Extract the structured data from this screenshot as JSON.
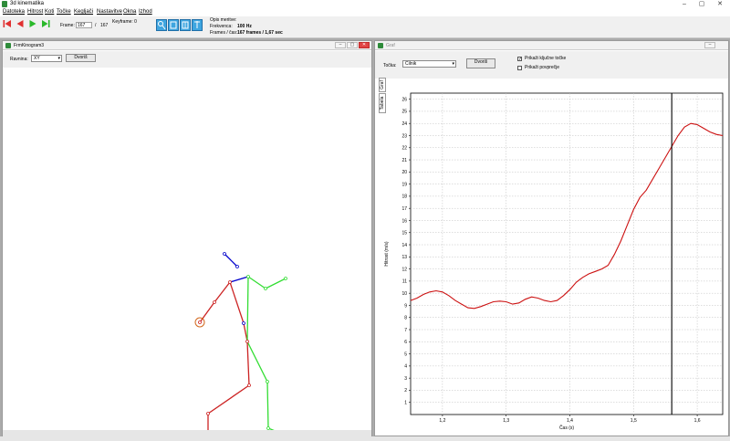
{
  "app": {
    "title": "3d kinematika"
  },
  "window_buttons": {
    "minimize": "–",
    "maximize": "▢",
    "close": "✕"
  },
  "menu": [
    "Datoteka",
    "Hitrost",
    "Koti",
    "Točke",
    "Kegljači",
    "Nastavitve",
    "Okna",
    "Izhod"
  ],
  "toolbar": {
    "frame_label": "Frame:",
    "frame_value": "167",
    "frame_separator": "/",
    "frame_total": "167",
    "keyframe_label": "Keyframe: 0",
    "info": {
      "desc_label": "Opis meritve:",
      "freq_label": "Frekvenca:",
      "freq_value": "100 Hz",
      "frames_label": "Frames / čas:",
      "frames_value": "167 frames / 1,67 sec"
    }
  },
  "left_window": {
    "title": "FrmKinogram3",
    "ravnina_label": "Ravnina:",
    "ravnina_value": "XY",
    "button_label": "Dvoriš"
  },
  "right_window": {
    "title": "Graf",
    "tocka_label": "Točka:",
    "tocka_value": "Cilnik",
    "button_label": "Dvoriš",
    "cb_kljucne": "Prikaži ključne točke",
    "cb_kljucne_checked": true,
    "cb_povprecje": "Prikaži povprečje",
    "cb_povprecje_checked": false,
    "vtab_1": "Graf",
    "vtab_2": "Tabela"
  },
  "colors": {
    "line": "#cc1111",
    "skeleton_left": "#cc2222",
    "skeleton_right": "#33dd33",
    "head": "#0000cc",
    "accent": "#3fa6e0"
  },
  "chart_data": {
    "type": "line",
    "xlabel": "Čas (s)",
    "ylabel": "Hitrost (m/s)",
    "xlim": [
      1.15,
      1.64
    ],
    "ylim": [
      0,
      26.5
    ],
    "xticks": [
      1.2,
      1.3,
      1.4,
      1.5,
      1.6
    ],
    "xtick_labels": [
      "1,2",
      "1,3",
      "1,4",
      "1,5",
      "1,6"
    ],
    "yticks": [
      1,
      2,
      3,
      4,
      5,
      6,
      7,
      8,
      9,
      10,
      11,
      12,
      13,
      14,
      15,
      16,
      17,
      18,
      19,
      20,
      21,
      22,
      23,
      24,
      25,
      26
    ],
    "grid": true,
    "marker_x": 1.56,
    "series": [
      {
        "x": [
          1.15,
          1.16,
          1.17,
          1.18,
          1.19,
          1.2,
          1.21,
          1.22,
          1.23,
          1.24,
          1.25,
          1.26,
          1.27,
          1.28,
          1.29,
          1.3,
          1.31,
          1.32,
          1.33,
          1.34,
          1.35,
          1.36,
          1.37,
          1.38,
          1.39,
          1.4,
          1.41,
          1.42,
          1.43,
          1.44,
          1.45,
          1.46,
          1.47,
          1.48,
          1.49,
          1.5,
          1.51,
          1.52,
          1.53,
          1.54,
          1.55,
          1.56,
          1.57,
          1.58,
          1.59,
          1.6,
          1.61,
          1.62,
          1.63,
          1.64
        ],
        "values": [
          9.4,
          9.6,
          9.9,
          10.1,
          10.2,
          10.1,
          9.8,
          9.4,
          9.1,
          8.8,
          8.75,
          8.9,
          9.1,
          9.3,
          9.35,
          9.3,
          9.1,
          9.2,
          9.5,
          9.7,
          9.6,
          9.4,
          9.3,
          9.4,
          9.8,
          10.3,
          10.9,
          11.3,
          11.6,
          11.8,
          12.0,
          12.3,
          13.2,
          14.3,
          15.6,
          16.9,
          17.9,
          18.5,
          19.4,
          20.3,
          21.2,
          22.1,
          23.0,
          23.7,
          24.0,
          23.9,
          23.6,
          23.3,
          23.1,
          23.0
        ]
      }
    ]
  },
  "skeleton": {
    "points": {
      "head_top": [
        243,
        275
      ],
      "head_bot": [
        257,
        289
      ],
      "neck": [
        249,
        306
      ],
      "shoulder_r": [
        269,
        300
      ],
      "hand_r": [
        310,
        302
      ],
      "elbow_r": [
        288,
        313
      ],
      "elbow_l": [
        232,
        328
      ],
      "hand_l": [
        216,
        350
      ],
      "hip_l": [
        264,
        351
      ],
      "hip_r": [
        268,
        371
      ],
      "knee_l": [
        270,
        419
      ],
      "foot_l": [
        225,
        450
      ],
      "toe_l": [
        225,
        470
      ],
      "knee_r": [
        290,
        415
      ],
      "foot_r": [
        291,
        466
      ],
      "toe_r": [
        311,
        474
      ]
    }
  }
}
